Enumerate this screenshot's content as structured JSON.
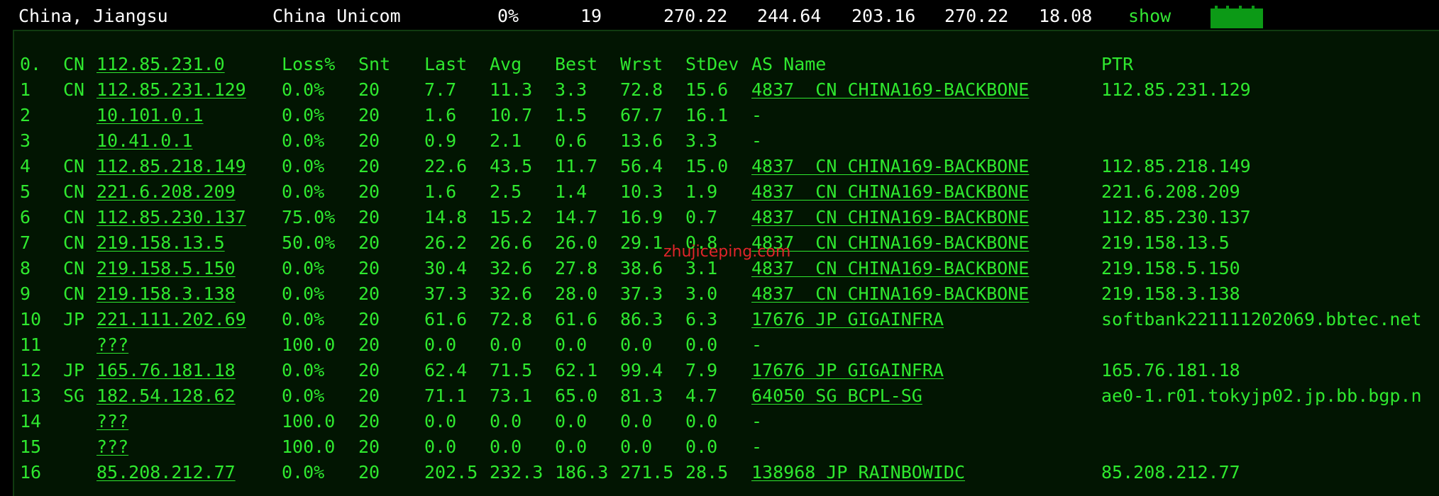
{
  "summary": {
    "location": "China, Jiangsu",
    "isp": "China Unicom",
    "loss": "0%",
    "sent": "19",
    "last": "270.22",
    "avg": "244.64",
    "best": "203.16",
    "worst": "270.22",
    "stdev": "18.08",
    "action_label": "show",
    "sparkline_color": "#0c9a16"
  },
  "trace": {
    "headers": {
      "hop": "0.",
      "cc": "CN",
      "host": "112.85.231.0",
      "loss": "Loss%",
      "snt": "Snt",
      "last": "Last",
      "avg": "Avg",
      "best": "Best",
      "wrst": "Wrst",
      "stdev": "StDev",
      "asname": "AS Name",
      "ptr": "PTR"
    },
    "rows": [
      {
        "hop": "1",
        "cc": "CN",
        "host": "112.85.231.129",
        "loss": "0.0%",
        "snt": "20",
        "last": "7.7",
        "avg": "11.3",
        "best": "3.3",
        "wrst": "72.8",
        "stdev": "15.6",
        "asname": "4837  CN CHINA169-BACKBONE",
        "ptr": "112.85.231.129"
      },
      {
        "hop": "2",
        "cc": "",
        "host": "10.101.0.1",
        "loss": "0.0%",
        "snt": "20",
        "last": "1.6",
        "avg": "10.7",
        "best": "1.5",
        "wrst": "67.7",
        "stdev": "16.1",
        "asname": "-",
        "ptr": ""
      },
      {
        "hop": "3",
        "cc": "",
        "host": "10.41.0.1",
        "loss": "0.0%",
        "snt": "20",
        "last": "0.9",
        "avg": "2.1",
        "best": "0.6",
        "wrst": "13.6",
        "stdev": "3.3",
        "asname": "-",
        "ptr": ""
      },
      {
        "hop": "4",
        "cc": "CN",
        "host": "112.85.218.149",
        "loss": "0.0%",
        "snt": "20",
        "last": "22.6",
        "avg": "43.5",
        "best": "11.7",
        "wrst": "56.4",
        "stdev": "15.0",
        "asname": "4837  CN CHINA169-BACKBONE",
        "ptr": "112.85.218.149"
      },
      {
        "hop": "5",
        "cc": "CN",
        "host": "221.6.208.209",
        "loss": "0.0%",
        "snt": "20",
        "last": "1.6",
        "avg": "2.5",
        "best": "1.4",
        "wrst": "10.3",
        "stdev": "1.9",
        "asname": "4837  CN CHINA169-BACKBONE",
        "ptr": "221.6.208.209"
      },
      {
        "hop": "6",
        "cc": "CN",
        "host": "112.85.230.137",
        "loss": "75.0%",
        "snt": "20",
        "last": "14.8",
        "avg": "15.2",
        "best": "14.7",
        "wrst": "16.9",
        "stdev": "0.7",
        "asname": "4837  CN CHINA169-BACKBONE",
        "ptr": "112.85.230.137"
      },
      {
        "hop": "7",
        "cc": "CN",
        "host": "219.158.13.5",
        "loss": "50.0%",
        "snt": "20",
        "last": "26.2",
        "avg": "26.6",
        "best": "26.0",
        "wrst": "29.1",
        "stdev": "0.8",
        "asname": "4837  CN CHINA169-BACKBONE",
        "ptr": "219.158.13.5"
      },
      {
        "hop": "8",
        "cc": "CN",
        "host": "219.158.5.150",
        "loss": "0.0%",
        "snt": "20",
        "last": "30.4",
        "avg": "32.6",
        "best": "27.8",
        "wrst": "38.6",
        "stdev": "3.1",
        "asname": "4837  CN CHINA169-BACKBONE",
        "ptr": "219.158.5.150"
      },
      {
        "hop": "9",
        "cc": "CN",
        "host": "219.158.3.138",
        "loss": "0.0%",
        "snt": "20",
        "last": "37.3",
        "avg": "32.6",
        "best": "28.0",
        "wrst": "37.3",
        "stdev": "3.0",
        "asname": "4837  CN CHINA169-BACKBONE",
        "ptr": "219.158.3.138"
      },
      {
        "hop": "10",
        "cc": "JP",
        "host": "221.111.202.69",
        "loss": "0.0%",
        "snt": "20",
        "last": "61.6",
        "avg": "72.8",
        "best": "61.6",
        "wrst": "86.3",
        "stdev": "6.3",
        "asname": "17676 JP GIGAINFRA",
        "ptr": "softbank221111202069.bbtec.net"
      },
      {
        "hop": "11",
        "cc": "",
        "host": "???",
        "loss": "100.0",
        "snt": "20",
        "last": "0.0",
        "avg": "0.0",
        "best": "0.0",
        "wrst": "0.0",
        "stdev": "0.0",
        "asname": "-",
        "ptr": ""
      },
      {
        "hop": "12",
        "cc": "JP",
        "host": "165.76.181.18",
        "loss": "0.0%",
        "snt": "20",
        "last": "62.4",
        "avg": "71.5",
        "best": "62.1",
        "wrst": "99.4",
        "stdev": "7.9",
        "asname": "17676 JP GIGAINFRA",
        "ptr": "165.76.181.18"
      },
      {
        "hop": "13",
        "cc": "SG",
        "host": "182.54.128.62",
        "loss": "0.0%",
        "snt": "20",
        "last": "71.1",
        "avg": "73.1",
        "best": "65.0",
        "wrst": "81.3",
        "stdev": "4.7",
        "asname": "64050 SG BCPL-SG",
        "ptr": "ae0-1.r01.tokyjp02.jp.bb.bgp.n"
      },
      {
        "hop": "14",
        "cc": "",
        "host": "???",
        "loss": "100.0",
        "snt": "20",
        "last": "0.0",
        "avg": "0.0",
        "best": "0.0",
        "wrst": "0.0",
        "stdev": "0.0",
        "asname": "-",
        "ptr": ""
      },
      {
        "hop": "15",
        "cc": "",
        "host": "???",
        "loss": "100.0",
        "snt": "20",
        "last": "0.0",
        "avg": "0.0",
        "best": "0.0",
        "wrst": "0.0",
        "stdev": "0.0",
        "asname": "-",
        "ptr": ""
      },
      {
        "hop": "16",
        "cc": "",
        "host": "85.208.212.77",
        "loss": "0.0%",
        "snt": "20",
        "last": "202.5",
        "avg": "232.3",
        "best": "186.3",
        "wrst": "271.5",
        "stdev": "28.5",
        "asname": "138968 JP RAINBOWIDC",
        "ptr": "85.208.212.77"
      }
    ]
  },
  "watermark": "zhujiceping.com"
}
